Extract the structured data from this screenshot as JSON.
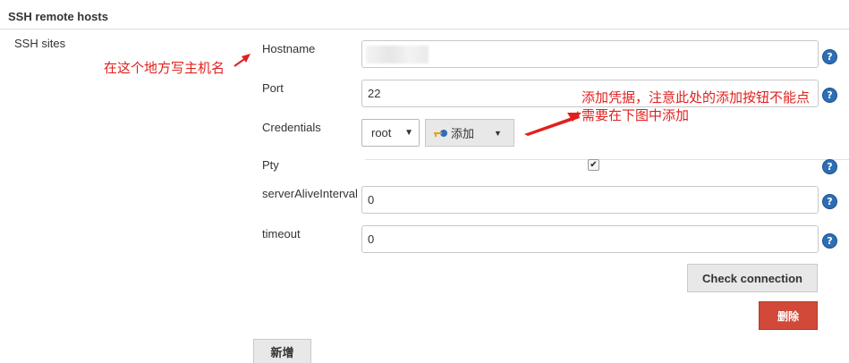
{
  "section": {
    "title": "SSH remote hosts"
  },
  "ssh_sites_label": "SSH sites",
  "fields": {
    "hostname": {
      "label": "Hostname",
      "value": ""
    },
    "port": {
      "label": "Port",
      "value": "22"
    },
    "credentials": {
      "label": "Credentials",
      "selected": "root",
      "add_label": "添加"
    },
    "pty": {
      "label": "Pty",
      "checked": true
    },
    "server_alive": {
      "label": "serverAliveInterval",
      "value": "0"
    },
    "timeout": {
      "label": "timeout",
      "value": "0"
    }
  },
  "buttons": {
    "check_connection": "Check connection",
    "delete": "删除",
    "add_new": "新增"
  },
  "annotations": {
    "hostname_note": "在这个地方写主机名",
    "credentials_note_line1": "添加凭据，注意此处的添加按钮不能点",
    "credentials_note_line2": "需要在下图中添加"
  },
  "icons": {
    "help": "help-icon",
    "key": "key-icon",
    "dropdown": "caret-down-icon",
    "check": "check-icon"
  },
  "colors": {
    "annotation": "#e0211e",
    "help": "#2e6eb5",
    "delete": "#d24939"
  }
}
